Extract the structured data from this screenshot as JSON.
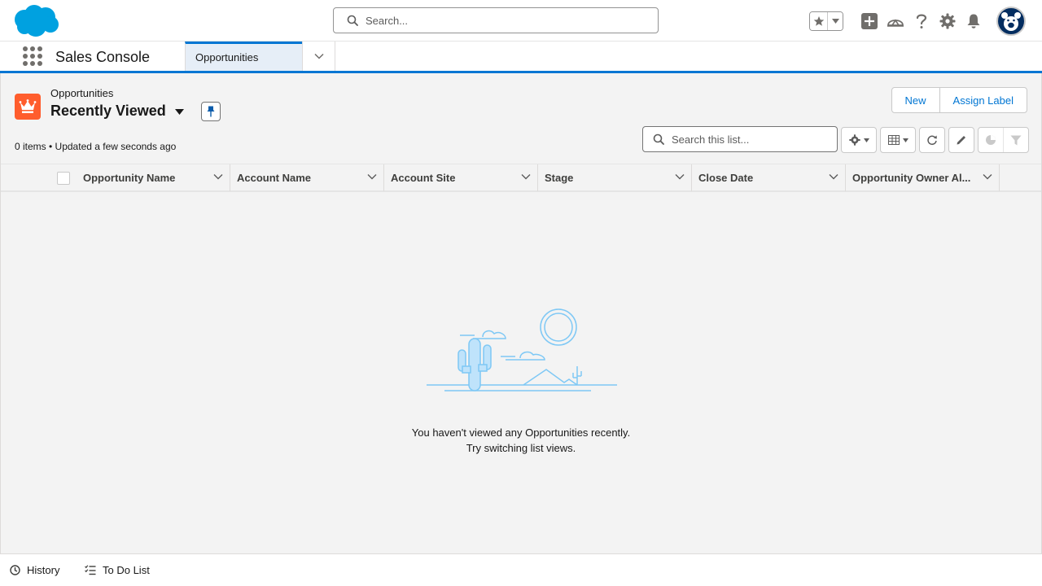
{
  "header": {
    "search_placeholder": "Search...",
    "icons": [
      "favorites-star-icon",
      "chevron-down-icon",
      "add-icon",
      "trailhead-icon",
      "help-icon",
      "setup-gear-icon",
      "notification-bell-icon",
      "avatar"
    ]
  },
  "nav": {
    "app_name": "Sales Console",
    "tab_label": "Opportunities"
  },
  "list": {
    "object_label": "Opportunities",
    "title": "Recently Viewed",
    "status": "0 items • Updated a few seconds ago",
    "search_placeholder": "Search this list...",
    "buttons": {
      "new": "New",
      "assign_label": "Assign Label"
    },
    "columns": [
      {
        "label": "Opportunity Name"
      },
      {
        "label": "Account Name"
      },
      {
        "label": "Account Site"
      },
      {
        "label": "Stage"
      },
      {
        "label": "Close Date"
      },
      {
        "label": "Opportunity Owner Al..."
      }
    ],
    "empty_message_line1": "You haven't viewed any Opportunities recently.",
    "empty_message_line2": "Try switching list views."
  },
  "utility": {
    "history": "History",
    "todo": "To Do List"
  },
  "colors": {
    "brand_blue": "#0176d3",
    "object_orange": "#ff5d2d",
    "cloud_blue": "#00a1e0"
  }
}
